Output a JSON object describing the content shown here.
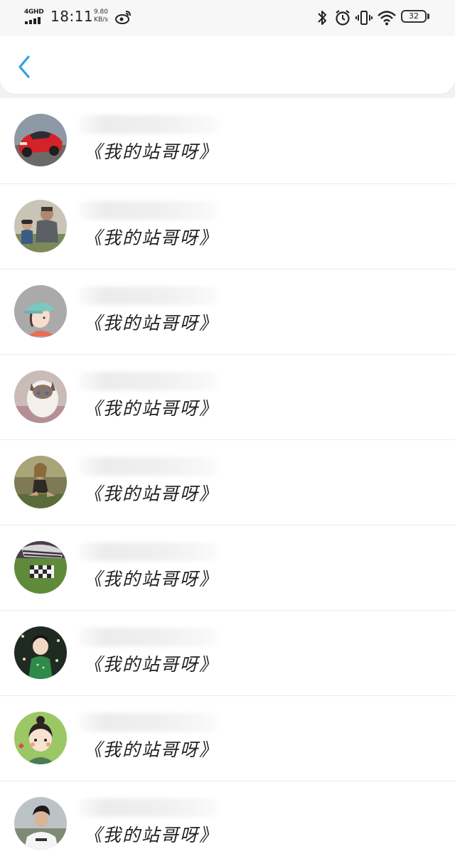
{
  "status_bar": {
    "network": "4GHD",
    "time": "18:11",
    "speed_value": "9.80",
    "speed_unit": "KB/s",
    "battery": "32",
    "icons": [
      "signal-icon",
      "weibo-icon",
      "bluetooth-icon",
      "alarm-icon",
      "vibrate-icon",
      "wifi-icon",
      "battery-icon"
    ]
  },
  "header": {
    "back_icon": "chevron-left-icon",
    "accent_color": "#2aa3e0"
  },
  "list": {
    "items": [
      {
        "subtitle": "《我的站哥呀》",
        "avatar": "red-toy-car"
      },
      {
        "subtitle": "《我的站哥呀》",
        "avatar": "father-and-child"
      },
      {
        "subtitle": "《我的站哥呀》",
        "avatar": "cartoon-cap-boy"
      },
      {
        "subtitle": "《我的站哥呀》",
        "avatar": "ragdoll-cat"
      },
      {
        "subtitle": "《我的站哥呀》",
        "avatar": "outdoor-girl"
      },
      {
        "subtitle": "《我的站哥呀》",
        "avatar": "striped-hat-grass"
      },
      {
        "subtitle": "《我的站哥呀》",
        "avatar": "little-girl-green-dress"
      },
      {
        "subtitle": "《我的站哥呀》",
        "avatar": "cartoon-girl"
      },
      {
        "subtitle": "《我的站哥呀》",
        "avatar": "young-man"
      }
    ]
  }
}
